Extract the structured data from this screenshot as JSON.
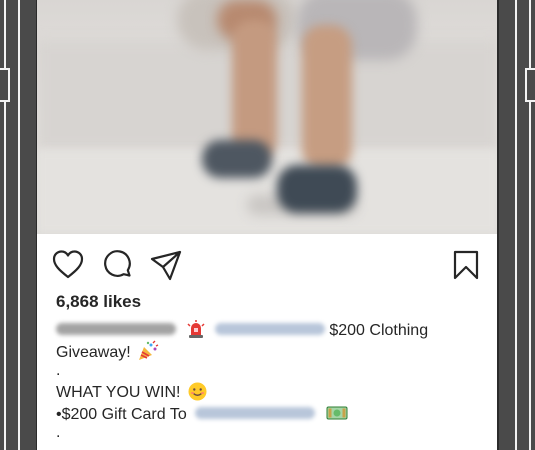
{
  "post": {
    "likes": "6,868 likes",
    "caption": {
      "line1_text": "$200 Clothing",
      "line2_text": "Giveaway!",
      "dot1": ".",
      "line3_text": "WHAT YOU WIN!",
      "line4_text": "•$200 Gift Card To",
      "dot2": "."
    }
  },
  "icons": {
    "like": "heart-icon",
    "comment": "comment-bubble-icon",
    "share": "paper-plane-icon",
    "save": "bookmark-icon",
    "siren": "siren-emoji",
    "party": "party-popper-emoji",
    "smile": "smiling-face-emoji",
    "money": "dollar-banknote-emoji"
  },
  "colors": {
    "text": "#262626",
    "mention_blur": "#b8c6da",
    "username_blur": "#9a9a9a"
  }
}
